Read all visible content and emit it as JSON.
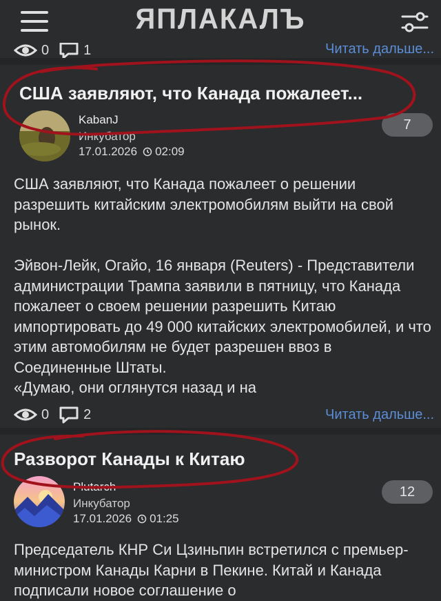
{
  "header": {
    "logo": "ЯПЛАКАЛЪ",
    "menu_icon": "hamburger-icon",
    "filter_icon": "filter-sliders-icon"
  },
  "prev_post": {
    "views": "0",
    "comments": "1",
    "read_more": "Читать дальше..."
  },
  "posts": [
    {
      "title": "США заявляют, что Канада пожалеет...",
      "author": "KabanJ",
      "role": "Инкубатор",
      "date": "17.01.2026",
      "time": "02:09",
      "badge": "7",
      "paragraphs": [
        "США заявляют, что Канада пожалеет о решении разрешить китайским электромобилям выйти на свой рынок.",
        "Эйвон-Лейк, Огайо, 16 января (Reuters) - Представители администрации Трампа заявили в пятницу, что Канада пожалеет о своем решении разрешить Китаю импортировать до 49 000 китайских электромобилей, и что этим автомобилям не будет разрешен ввоз в Соединенные Штаты.",
        "«Думаю, они оглянутся назад и на"
      ],
      "views": "0",
      "comments": "2",
      "read_more": "Читать дальше..."
    },
    {
      "title": "Разворот Канады к Китаю",
      "author": "Plutarch",
      "role": "Инкубатор",
      "date": "17.01.2026",
      "time": "01:25",
      "badge": "12",
      "paragraphs": [
        "Председатель КНР Си Цзиньпин встретился с премьер-министром Канады Карни в Пекине. Китай и Канада подписали новое соглашение о"
      ]
    }
  ],
  "colors": {
    "background": "#2b2c2e",
    "link": "#5b8ed6",
    "annotation": "#a0121c"
  }
}
